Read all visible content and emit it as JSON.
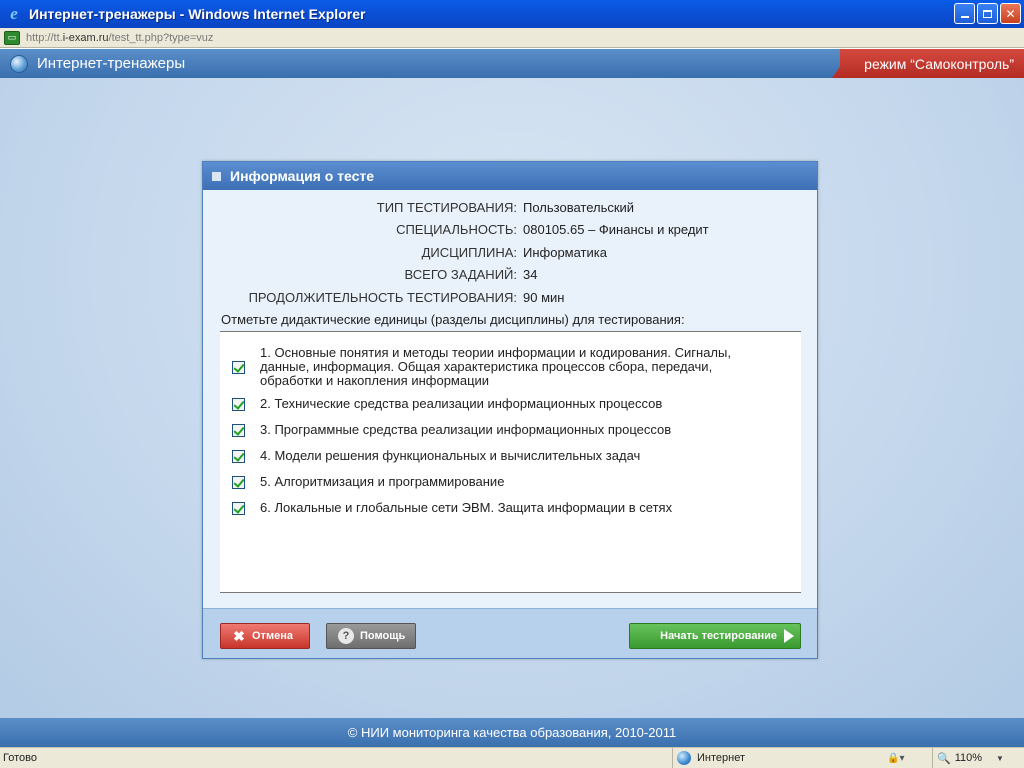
{
  "window": {
    "title": "Интернет-тренажеры - Windows Internet Explorer",
    "url_prefix": "http://tt.",
    "url_domain": "i-exam.ru",
    "url_rest": "/test_tt.php?type=vuz"
  },
  "app": {
    "title": "Интернет-тренажеры",
    "mode": "режим “Самоконтроль”"
  },
  "dialog": {
    "title": "Информация о тесте",
    "info": [
      {
        "label": "ТИП ТЕСТИРОВАНИЯ:",
        "value": "Пользовательский"
      },
      {
        "label": "СПЕЦИАЛЬНОСТЬ:",
        "value": "080105.65 – Финансы и кредит"
      },
      {
        "label": "ДИСЦИПЛИНА:",
        "value": "Информатика"
      },
      {
        "label": "ВСЕГО ЗАДАНИЙ:",
        "value": "34"
      },
      {
        "label": "ПРОДОЛЖИТЕЛЬНОСТЬ ТЕСТИРОВАНИЯ:",
        "value": "90 мин"
      }
    ],
    "instruction": "Отметьте дидактические единицы (разделы дисциплины) для тестирования:",
    "units": [
      {
        "text": "1. Основные понятия и методы теории информации и кодирования. Сигналы, данные, информация. Общая характеристика процессов сбора, передачи, обработки и накопления информации",
        "checked": true
      },
      {
        "text": "2. Технические средства реализации информационных процессов",
        "checked": true
      },
      {
        "text": "3. Программные средства реализации информационных процессов",
        "checked": true
      },
      {
        "text": "4. Модели решения функциональных и вычислительных задач",
        "checked": true
      },
      {
        "text": "5. Алгоритмизация и программирование",
        "checked": true
      },
      {
        "text": "6. Локальные и глобальные сети ЭВМ. Защита информации в сетях",
        "checked": true
      }
    ],
    "buttons": {
      "cancel": "Отмена",
      "help": "Помощь",
      "start": "Начать тестирование"
    }
  },
  "footer": {
    "copyright": "© НИИ мониторинга качества образования, 2010-2011"
  },
  "statusbar": {
    "status": "Готово",
    "zone": "Интернет",
    "zoom": "110%"
  }
}
